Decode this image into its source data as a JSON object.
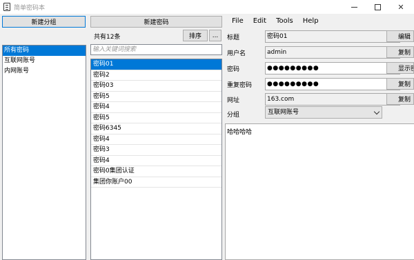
{
  "window": {
    "title": "简单密码本",
    "icon": "notebook-icon"
  },
  "left": {
    "new_group_label": "新建分组",
    "groups": [
      {
        "label": "所有密码",
        "selected": true
      },
      {
        "label": "互联网账号",
        "selected": false
      },
      {
        "label": "内网账号",
        "selected": false
      }
    ]
  },
  "middle": {
    "new_password_label": "新建密码",
    "count_text": "共有12条",
    "sort_label": "排序",
    "more_label": "...",
    "search_placeholder": "输入关键词搜索",
    "items": [
      {
        "label": "密码01",
        "selected": true
      },
      {
        "label": "密码2",
        "selected": false
      },
      {
        "label": "密码03",
        "selected": false
      },
      {
        "label": "密码5",
        "selected": false
      },
      {
        "label": "密码4",
        "selected": false
      },
      {
        "label": "密码5",
        "selected": false
      },
      {
        "label": "密码6345",
        "selected": false
      },
      {
        "label": "密码4",
        "selected": false
      },
      {
        "label": "密码3",
        "selected": false
      },
      {
        "label": "密码4",
        "selected": false
      },
      {
        "label": "密码0集团认证",
        "selected": false
      },
      {
        "label": "集团你账户00",
        "selected": false
      }
    ]
  },
  "menu": [
    "File",
    "Edit",
    "Tools",
    "Help"
  ],
  "detail": {
    "title_label": "标题",
    "title_value": "密码01",
    "edit_label": "编辑",
    "username_label": "用户名",
    "username_value": "admin",
    "copy_username_label": "复制",
    "password_label": "密码",
    "password_value": "●●●●●●●●●",
    "show_label": "显示密码",
    "repeat_password_label": "重复密码",
    "repeat_password_value": "●●●●●●●●●",
    "copy_password_label": "复制",
    "url_label": "网址",
    "url_value": "163.com",
    "copy_url_label": "复制",
    "group_label": "分组",
    "group_value": "互联网账号",
    "notes_value": "哈哈哈哈"
  },
  "colors": {
    "selection": "#0078d7",
    "panel_bg": "#f0f0f0",
    "button_bg": "#e1e1e1"
  }
}
